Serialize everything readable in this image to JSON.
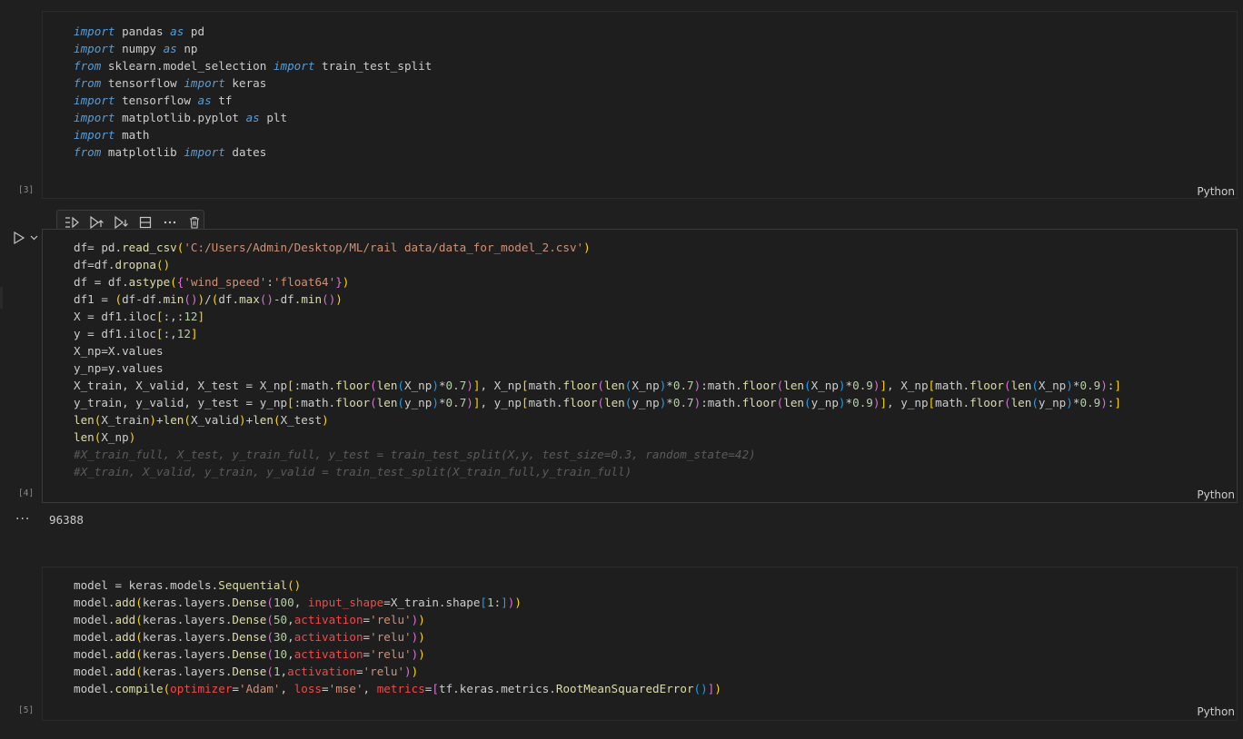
{
  "cells": [
    {
      "exec_count": "[3]",
      "language": "Python",
      "lines": [
        "import pandas as pd",
        "import numpy as np",
        "from sklearn.model_selection import train_test_split",
        "from tensorflow import keras",
        "import tensorflow as tf",
        "import matplotlib.pyplot as plt",
        "import math",
        "from matplotlib import dates"
      ]
    },
    {
      "exec_count": "[4]",
      "language": "Python",
      "lines": [
        "df= pd.read_csv('C:/Users/Admin/Desktop/ML/rail data/data_for_model_2.csv')",
        "df=df.dropna()",
        "df = df.astype({'wind_speed':'float64'})",
        "df1 = (df-df.min())/(df.max()-df.min())",
        "X = df1.iloc[:,:12]",
        "y = df1.iloc[:,12]",
        "X_np=X.values",
        "y_np=y.values",
        "X_train, X_valid, X_test = X_np[:math.floor(len(X_np)*0.7)], X_np[math.floor(len(X_np)*0.7):math.floor(len(X_np)*0.9)], X_np[math.floor(len(X_np)*0.9):]",
        "y_train, y_valid, y_test = y_np[:math.floor(len(y_np)*0.7)], y_np[math.floor(len(y_np)*0.7):math.floor(len(y_np)*0.9)], y_np[math.floor(len(y_np)*0.9):]",
        "len(X_train)+len(X_valid)+len(X_test)",
        "len(X_np)",
        "#X_train_full, X_test, y_train_full, y_test = train_test_split(X,y, test_size=0.3, random_state=42)",
        "#X_train, X_valid, y_train, y_valid = train_test_split(X_train_full,y_train_full)"
      ],
      "output": "96388"
    },
    {
      "exec_count": "[5]",
      "language": "Python",
      "lines": [
        "model = keras.models.Sequential()",
        "model.add(keras.layers.Dense(100, input_shape=X_train.shape[1:]))",
        "model.add(keras.layers.Dense(50,activation='relu'))",
        "model.add(keras.layers.Dense(30,activation='relu'))",
        "model.add(keras.layers.Dense(10,activation='relu'))",
        "model.add(keras.layers.Dense(1,activation='relu'))",
        "model.compile(optimizer='Adam', loss='mse', metrics=[tf.keras.metrics.RootMeanSquaredError()])"
      ]
    }
  ],
  "toolbar": {
    "icons": [
      "execute-above-icon",
      "run-above-icon",
      "run-below-icon",
      "split-cell-icon",
      "more-icon",
      "delete-icon"
    ]
  },
  "output_ellipsis": "···",
  "colors": {
    "background": "#1f1f1f",
    "cell_background": "#1e1e1e",
    "keyword": "#569cd6",
    "string": "#ce9178",
    "number": "#b5cea8",
    "function": "#dcdcaa",
    "parameter": "#f44747",
    "comment": "#5a5a5a"
  }
}
